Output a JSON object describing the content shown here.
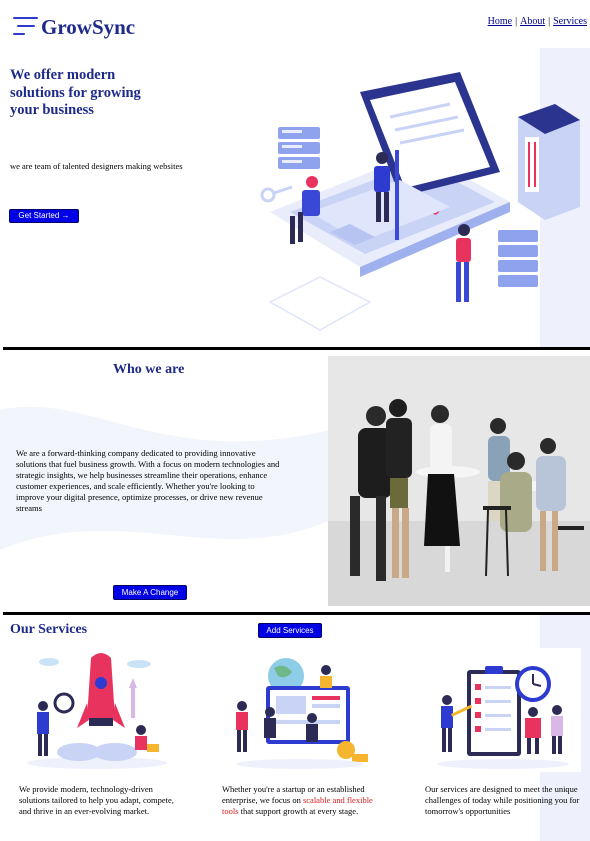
{
  "brand": {
    "name": "GrowSync",
    "logo_icon": "menu-lines-icon"
  },
  "nav": {
    "items": [
      "Home",
      "About",
      "Services"
    ],
    "separator": "|"
  },
  "hero": {
    "title": "We offer modern solutions for growing your business",
    "subtitle": "we are team of talented designers making websites",
    "cta_label": "Get Started →"
  },
  "who": {
    "title": "Who we are",
    "text": "We are a forward-thinking company dedicated to providing innovative solutions that fuel business growth. With a focus on modern technologies and strategic insights, we help businesses streamline their operations, enhance customer experiences, and scale efficiently. Whether you're looking to improve your digital presence, optimize processes, or drive new revenue streams",
    "cta_label": "Make A Change"
  },
  "services": {
    "title": "Our Services",
    "add_label": "Add Services",
    "cards": [
      {
        "text": "We provide modern, technology-driven solutions tailored to help you adapt, compete, and thrive in an ever-evolving market."
      },
      {
        "text_before": "Whether you're a startup or an established enterprise, we focus on ",
        "highlight": "scalable and flexible tools",
        "text_after": " that support growth at every stage."
      },
      {
        "text": "Our services are designed to meet the unique challenges of today while positioning you for tomorrow's opportunities"
      }
    ]
  },
  "colors": {
    "brand": "#1e2a8a",
    "button": "#0000e6",
    "accent_red": "#d81b1b",
    "stripe": "#eef1fb"
  }
}
